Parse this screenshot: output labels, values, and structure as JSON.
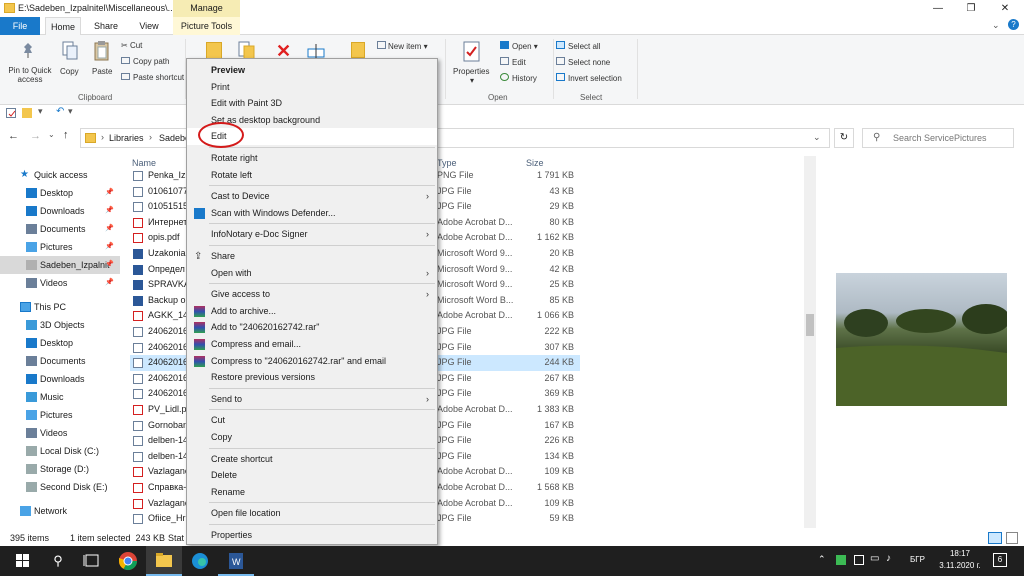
{
  "window": {
    "title": "E:\\Sadeben_Izpalnitel\\Miscellaneous\\...",
    "manage_label": "Manage",
    "buttons": {
      "minimize": "—",
      "maximize": "❐",
      "close": "✕"
    }
  },
  "ribbon_tabs": [
    "File",
    "Home",
    "Share",
    "View",
    "Picture Tools"
  ],
  "ribbon": {
    "clipboard": {
      "pin_quick_access": "Pin to Quick access",
      "copy": "Copy",
      "paste": "Paste",
      "cut": "Cut",
      "copy_path": "Copy path",
      "paste_shortcut": "Paste shortcut",
      "group": "Clipboard"
    },
    "new_item": "New item",
    "properties": "Properties",
    "open": {
      "open": "Open",
      "edit": "Edit",
      "history": "History",
      "group": "Open"
    },
    "select": {
      "select_all": "Select all",
      "select_none": "Select none",
      "invert": "Invert selection",
      "group": "Select"
    }
  },
  "address": {
    "crumbs": [
      "Libraries",
      "Sadebe"
    ],
    "search_placeholder": "Search ServicePictures"
  },
  "nav": {
    "quick_access": "Quick access",
    "quick_items": [
      "Desktop",
      "Downloads",
      "Documents",
      "Pictures",
      "Sadeben_Izpalnit",
      "Videos"
    ],
    "this_pc": "This PC",
    "pc_items": [
      "3D Objects",
      "Desktop",
      "Documents",
      "Downloads",
      "Music",
      "Pictures",
      "Videos",
      "Local Disk (C:)",
      "Storage (D:)",
      "Second Disk (E:)"
    ],
    "network": "Network"
  },
  "columns": {
    "name": "Name",
    "type": "Type",
    "size": "Size"
  },
  "files": [
    {
      "name": "Penka_Iz",
      "type": "PNG File",
      "size": "1 791 KB",
      "icon": "image"
    },
    {
      "name": "01061077",
      "type": "JPG File",
      "size": "43 KB",
      "icon": "image"
    },
    {
      "name": "01051515",
      "type": "JPG File",
      "size": "29 KB",
      "icon": "image"
    },
    {
      "name": "Интернет",
      "type": "Adobe Acrobat D...",
      "size": "80 KB",
      "icon": "pdf"
    },
    {
      "name": "opis.pdf",
      "type": "Adobe Acrobat D...",
      "size": "1 162 KB",
      "icon": "pdf"
    },
    {
      "name": "Uzakonia",
      "type": "Microsoft Word 9...",
      "size": "20 KB",
      "icon": "word"
    },
    {
      "name": "Определ",
      "type": "Microsoft Word 9...",
      "size": "42 KB",
      "icon": "word"
    },
    {
      "name": "SPRAVKA",
      "type": "Microsoft Word 9...",
      "size": "25 KB",
      "icon": "word"
    },
    {
      "name": "Backup o",
      "type": "Microsoft Word B...",
      "size": "85 KB",
      "icon": "word"
    },
    {
      "name": "AGKK_14",
      "type": "Adobe Acrobat D...",
      "size": "1 066 KB",
      "icon": "pdf"
    },
    {
      "name": "24062016",
      "type": "JPG File",
      "size": "222 KB",
      "icon": "image"
    },
    {
      "name": "24062016",
      "type": "JPG File",
      "size": "307 KB",
      "icon": "image"
    },
    {
      "name": "24062016",
      "type": "JPG File",
      "size": "244 KB",
      "icon": "image",
      "selected": true
    },
    {
      "name": "24062016",
      "type": "JPG File",
      "size": "267 KB",
      "icon": "image"
    },
    {
      "name": "24062016",
      "type": "JPG File",
      "size": "369 KB",
      "icon": "image"
    },
    {
      "name": "PV_Lidl.p",
      "type": "Adobe Acrobat D...",
      "size": "1 383 KB",
      "icon": "pdf"
    },
    {
      "name": "Gornoban",
      "type": "JPG File",
      "size": "167 KB",
      "icon": "image"
    },
    {
      "name": "delben-14",
      "type": "JPG File",
      "size": "226 KB",
      "icon": "image"
    },
    {
      "name": "delben-14",
      "type": "JPG File",
      "size": "134 KB",
      "icon": "image"
    },
    {
      "name": "Vazlagane",
      "type": "Adobe Acrobat D...",
      "size": "109 KB",
      "icon": "pdf"
    },
    {
      "name": "Справка-",
      "type": "Adobe Acrobat D...",
      "size": "1 568 KB",
      "icon": "pdf"
    },
    {
      "name": "Vazlagane",
      "type": "Adobe Acrobat D...",
      "size": "109 KB",
      "icon": "pdf"
    },
    {
      "name": "Ofiice_Hr",
      "type": "JPG File",
      "size": "59 KB",
      "icon": "image"
    }
  ],
  "context_menu": [
    {
      "label": "Preview",
      "bold": true
    },
    {
      "label": "Print"
    },
    {
      "label": "Edit with Paint 3D"
    },
    {
      "label": "Set as desktop background"
    },
    {
      "label": "Edit",
      "highlight": true
    },
    {
      "sep": true
    },
    {
      "label": "Rotate right"
    },
    {
      "label": "Rotate left"
    },
    {
      "sep": true
    },
    {
      "label": "Cast to Device",
      "submenu": true
    },
    {
      "label": "Scan with Windows Defender...",
      "icon": "defender"
    },
    {
      "sep": true
    },
    {
      "label": "InfoNotary e-Doc Signer",
      "submenu": true
    },
    {
      "sep": true
    },
    {
      "label": "Share",
      "icon": "share"
    },
    {
      "label": "Open with",
      "submenu": true
    },
    {
      "sep": true
    },
    {
      "label": "Give access to",
      "submenu": true
    },
    {
      "label": "Add to archive...",
      "icon": "rar"
    },
    {
      "label": "Add to \"240620162742.rar\"",
      "icon": "rar"
    },
    {
      "label": "Compress and email...",
      "icon": "rar"
    },
    {
      "label": "Compress to \"240620162742.rar\" and email",
      "icon": "rar"
    },
    {
      "label": "Restore previous versions"
    },
    {
      "sep": true
    },
    {
      "label": "Send to",
      "submenu": true
    },
    {
      "sep": true
    },
    {
      "label": "Cut"
    },
    {
      "label": "Copy"
    },
    {
      "sep": true
    },
    {
      "label": "Create shortcut"
    },
    {
      "label": "Delete"
    },
    {
      "label": "Rename"
    },
    {
      "sep": true
    },
    {
      "label": "Open file location"
    },
    {
      "sep": true
    },
    {
      "label": "Properties"
    }
  ],
  "status": {
    "items": "395 items",
    "selected": "1 item selected  243 KB",
    "state": "Stat"
  },
  "taskbar": {
    "time": "18:17",
    "date": "3.11.2020 г.",
    "lang": "БГР",
    "notif_count": "6"
  },
  "colors": {
    "accent": "#1979ca",
    "selection": "#cce8ff",
    "circle": "#d41a1a"
  }
}
